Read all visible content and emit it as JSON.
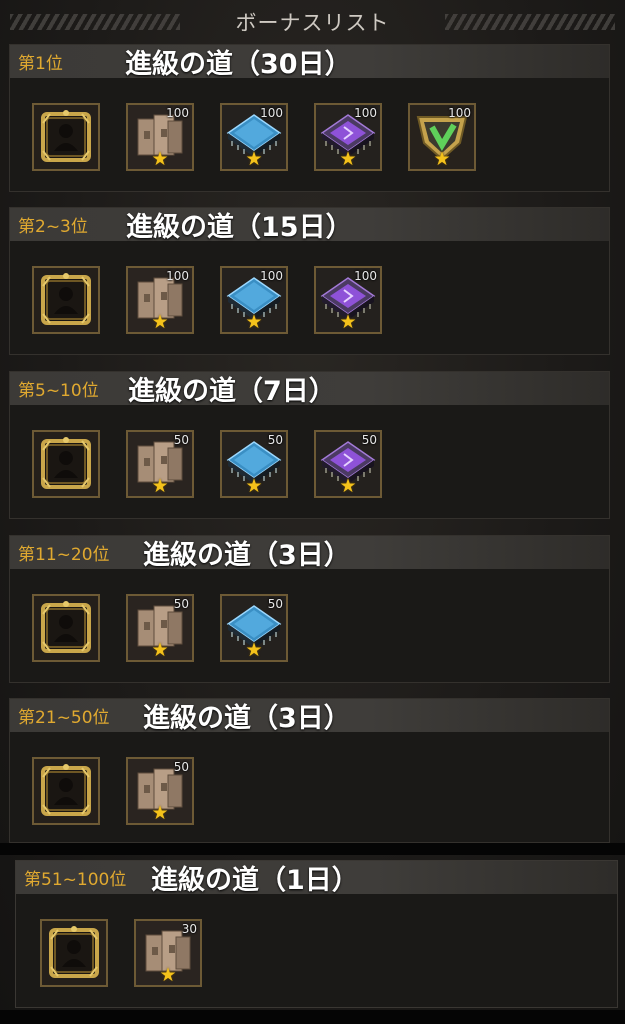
{
  "header": {
    "title": "ボーナスリスト"
  },
  "sections": [
    {
      "rank": "第1位",
      "title": "進級の道（30日）",
      "items": [
        {
          "type": "frame",
          "qty": ""
        },
        {
          "type": "book",
          "qty": "100"
        },
        {
          "type": "blue-chip",
          "qty": "100"
        },
        {
          "type": "purple-chip",
          "qty": "100"
        },
        {
          "type": "green-emblem",
          "qty": "100"
        }
      ]
    },
    {
      "rank": "第2~3位",
      "title": "進級の道（15日）",
      "items": [
        {
          "type": "frame",
          "qty": ""
        },
        {
          "type": "book",
          "qty": "100"
        },
        {
          "type": "blue-chip",
          "qty": "100"
        },
        {
          "type": "purple-chip",
          "qty": "100"
        }
      ]
    },
    {
      "rank": "第5~10位",
      "title": "進級の道（7日）",
      "items": [
        {
          "type": "frame",
          "qty": ""
        },
        {
          "type": "book",
          "qty": "50"
        },
        {
          "type": "blue-chip",
          "qty": "50"
        },
        {
          "type": "purple-chip",
          "qty": "50"
        }
      ]
    },
    {
      "rank": "第11~20位",
      "title": "進級の道（3日）",
      "items": [
        {
          "type": "frame",
          "qty": ""
        },
        {
          "type": "book",
          "qty": "50"
        },
        {
          "type": "blue-chip",
          "qty": "50"
        }
      ]
    },
    {
      "rank": "第21~50位",
      "title": "進級の道（3日）",
      "items": [
        {
          "type": "frame",
          "qty": ""
        },
        {
          "type": "book",
          "qty": "50"
        }
      ]
    },
    {
      "rank": "第51~100位",
      "title": "進級の道（1日）",
      "items": [
        {
          "type": "frame",
          "qty": ""
        },
        {
          "type": "book",
          "qty": "30"
        }
      ]
    }
  ],
  "colors": {
    "rank_text": "#e0a930",
    "star": "#f4c21b",
    "header_bg": "#3c3a37"
  }
}
